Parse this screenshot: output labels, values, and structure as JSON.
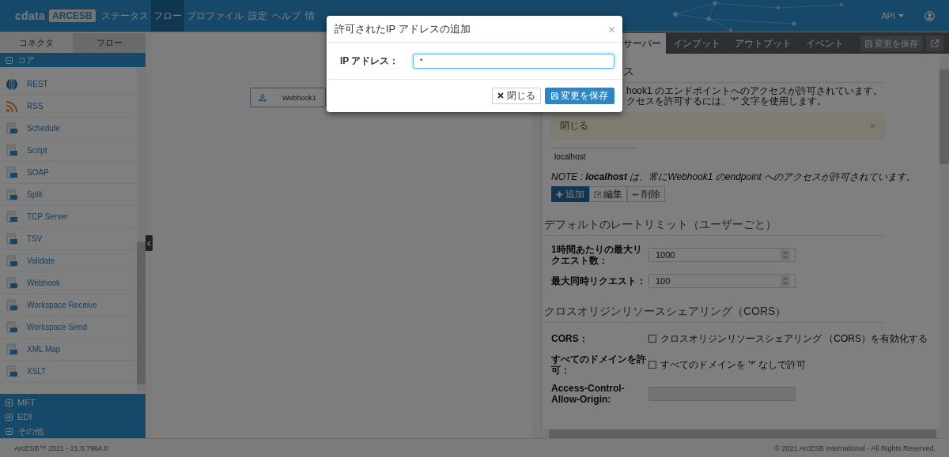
{
  "header": {
    "logo": "cdata",
    "product": "ARCESB",
    "nav": [
      {
        "label": "ステータス",
        "selected": false
      },
      {
        "label": "フロー",
        "selected": true
      },
      {
        "label": "プロファイル",
        "selected": false
      },
      {
        "label": "設定",
        "selected": false
      },
      {
        "label": "ヘルプ",
        "selected": false
      },
      {
        "label": "情",
        "selected": false
      }
    ],
    "api_menu": "API"
  },
  "sidebar": {
    "tabs": [
      {
        "label": "コネクタ",
        "selected": true
      },
      {
        "label": "フロー",
        "selected": false
      }
    ],
    "groups": [
      {
        "label": "コア",
        "expanded": true,
        "items": [
          "REST",
          "RSS",
          "Schedule",
          "Script",
          "SOAP",
          "Split",
          "TCP Server",
          "TSV",
          "Validate",
          "Webhook",
          "Workspace Receive",
          "Workspace Send",
          "XML Map",
          "XSLT"
        ]
      },
      {
        "label": "MFT",
        "expanded": false
      },
      {
        "label": "EDI",
        "expanded": false
      },
      {
        "label": "その他",
        "expanded": false
      }
    ]
  },
  "canvas": {
    "nodes": [
      {
        "label": "Webhook1"
      }
    ]
  },
  "panel": {
    "tabs": [
      {
        "label": "サーバー",
        "selected": true
      },
      {
        "label": "インプット",
        "selected": false
      },
      {
        "label": "アウトプット",
        "selected": false
      },
      {
        "label": "イベント",
        "selected": false
      }
    ],
    "save_button": "変更を保存",
    "access": {
      "title": "ス",
      "lines": [
        "hook1 のエンドポイントへのアクセスが許可されています。",
        "クセスを許可するには、'*' 文字を使用します。"
      ],
      "alert": "閉じる",
      "list": [
        "localhost"
      ],
      "note": "NOTE : **localhost** は、常にWebhook1 のendpoint へのアクセスが許可されています。",
      "buttons": [
        {
          "label": "追加",
          "kind": "add"
        },
        {
          "label": "編集",
          "kind": "edit"
        },
        {
          "label": "削除",
          "kind": "remove"
        }
      ]
    },
    "sections": [
      {
        "title": "デフォルトのレートリミット（ユーザーごと）",
        "rows": [
          {
            "kind": "number",
            "label": "1時間あたりの最大リクエスト数：",
            "value": "1000"
          },
          {
            "kind": "number",
            "label": "最大同時リクエスト：",
            "value": "100"
          }
        ]
      },
      {
        "title": "クロスオリジンリソースシェアリング（CORS）",
        "rows": [
          {
            "kind": "checkbox",
            "label": "CORS：",
            "text": "クロスオリジンリソースシェアリング （CORS）を有効化する",
            "checked": false
          },
          {
            "kind": "checkbox",
            "label": "すべてのドメインを許可：",
            "text": "すべてのドメインを '*' なしで許可",
            "checked": false
          },
          {
            "kind": "text",
            "label": "Access-Control-Allow-Origin:",
            "disabled": true
          }
        ]
      }
    ]
  },
  "modal": {
    "title": "許可されたIP アドレスの追加",
    "field_label": "IP アドレス：",
    "value": "*",
    "buttons": [
      {
        "label": "閉じる",
        "kind": "close"
      },
      {
        "label": "変更を保存",
        "kind": "save"
      }
    ]
  },
  "footer": {
    "version": "ArcESB™ 2021 - 21.0.7964.0",
    "copyright": "© 2021 ArcESB International - All Rights Reserved."
  }
}
